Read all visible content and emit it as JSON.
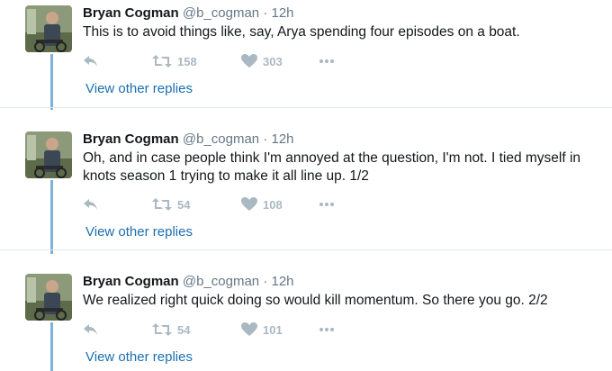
{
  "tweets": [
    {
      "author_name": "Bryan Cogman",
      "handle": "@b_cogman",
      "separator": "·",
      "time": "12h",
      "text": "This is to avoid things like, say, Arya spending four episodes on a boat.",
      "retweets": "158",
      "likes": "303",
      "view_replies": "View other replies"
    },
    {
      "author_name": "Bryan Cogman",
      "handle": "@b_cogman",
      "separator": "·",
      "time": "12h",
      "text": "Oh, and in case people think I'm annoyed at the question, I'm not. I tied myself in knots season 1 trying to make it all line up. 1/2",
      "retweets": "54",
      "likes": "108",
      "view_replies": "View other replies"
    },
    {
      "author_name": "Bryan Cogman",
      "handle": "@b_cogman",
      "separator": "·",
      "time": "12h",
      "text": "We realized right quick doing so would kill momentum. So there you go. 2/2",
      "retweets": "54",
      "likes": "101",
      "view_replies": "View other replies"
    }
  ],
  "icons": {
    "reply": "reply-icon",
    "retweet": "retweet-icon",
    "like": "heart-icon",
    "more": "more-icon"
  },
  "colors": {
    "thread_line": "#7fb2d9",
    "link": "#1b6fb0",
    "action_gray": "#aab8c2",
    "separator": "#e1e8ed"
  }
}
